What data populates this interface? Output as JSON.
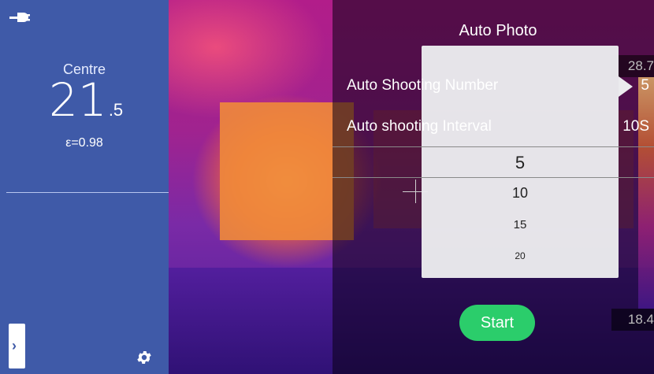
{
  "left_panel": {
    "plug_icon": "power-plug-icon",
    "centre_label": "Centre",
    "temp_integer": "21",
    "temp_decimal": ".5",
    "emissivity": "ε=0.98",
    "expand_icon": "chevron-right-icon",
    "settings_icon": "gear-icon"
  },
  "dialog": {
    "title": "Auto Photo",
    "rows": [
      {
        "label": "Auto Shooting Number",
        "value": "5"
      },
      {
        "label": "Auto shooting Interval",
        "value": "10S"
      }
    ],
    "options": [
      "5",
      "10",
      "15",
      "20"
    ],
    "start_label": "Start"
  },
  "scale": {
    "max": "28.7",
    "min": "18.4"
  },
  "colors": {
    "panel_blue": "#3f5aa8",
    "start_green": "#2bcd6b"
  }
}
